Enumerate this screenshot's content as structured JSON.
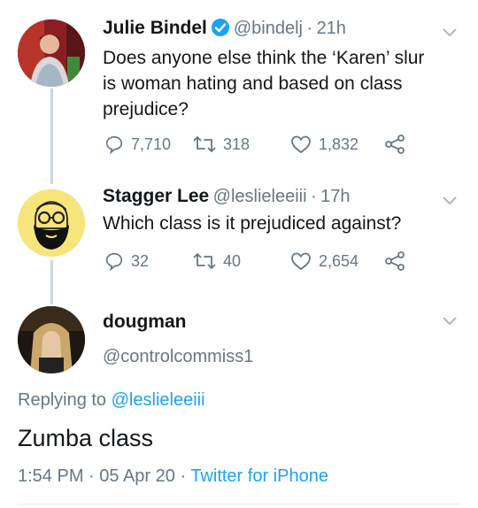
{
  "tweets": [
    {
      "name": "Julie Bindel",
      "handle": "@bindelj",
      "sep": "·",
      "time": "21h",
      "text_lines": [
        "Does anyone else think the ‘Karen’ slur",
        "is woman hating and based on class",
        "prejudice?"
      ],
      "replies": "7,710",
      "retweets": "318",
      "likes": "1,832",
      "verified": true
    },
    {
      "name": "Stagger Lee",
      "handle": "@leslieleeiii",
      "sep": "·",
      "time": "17h",
      "text_lines": [
        "Which class is it prejudiced against?"
      ],
      "replies": "32",
      "retweets": "40",
      "likes": "2,654"
    }
  ],
  "focus": {
    "name": "dougman",
    "handle": "@controlcommiss1",
    "replying_prefix": "Replying to",
    "replying_to": "@leslieleeiii",
    "text": "Zumba class",
    "timestamp": "1:54 PM · 05 Apr 20 ·",
    "source": "Twitter for iPhone"
  },
  "colors": {
    "link": "#1da1f2",
    "muted": "#657786",
    "thread_line": "#ccd6dd",
    "stagger_avatar_bg": "#f6e57a"
  }
}
